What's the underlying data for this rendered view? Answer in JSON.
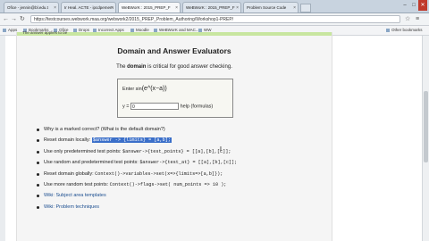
{
  "browser": {
    "tabs": [
      {
        "label": "Ofice - jennin@bl.edu.t"
      },
      {
        "label": "Ir Heal. ACTE - ipcdpemem"
      },
      {
        "label": "WeBWorK : 2015_PREP_F"
      },
      {
        "label": "WeBWorK : 2015_PREP_F"
      },
      {
        "label": "Problem Source Code"
      }
    ],
    "window_controls": {
      "min": "–",
      "max": "□",
      "close": "✕"
    },
    "url": "https://testcourses.webwork.maa.org/webwork2/2015_PREP_Problem_Authoring/Workshop1-PREP/",
    "bookmarks": [
      "Apps",
      "Bookmarks",
      "Ofice",
      "Drops",
      "Incorrect Apps",
      "Moodle",
      "WeBWorK and MAC...",
      "WW"
    ],
    "other_bookmarks": "Other bookmarks"
  },
  "page": {
    "header_partial": "The answer applies to be",
    "title": "Domain and Answer Evaluators",
    "intro_pre": "The ",
    "intro_bold": "domain",
    "intro_post": " is critical for good answer checking.",
    "demo": {
      "enter_label": "Enter sin",
      "enter_expr": "(e^(x−a))",
      "y_label": "y =",
      "y_value": "0",
      "help_text": "help (formulas)"
    },
    "items": [
      {
        "text": "Why is ",
        "code": "a",
        "after": " marked correct? (What is the default domain?)"
      },
      {
        "text": "Reset domain locally: ",
        "highlight": "$answer -> {limits} = [a,b];"
      },
      {
        "text": "Use only predetermined test points: ",
        "code": "$answer->{test_points} = [[a],[b],[c]];"
      },
      {
        "text": "Use random and predetermined test points: ",
        "code": "$answer->{test_at} = [[a],[b],[c]];"
      },
      {
        "text": "Reset domain globally: ",
        "code": "Context()->variables->set(x=>{limits=>[a,b]});"
      },
      {
        "text": "Use more random test points: ",
        "code": "Context()->flags->set( num_points => 10 );"
      },
      {
        "text": "",
        "link": "Wiki: Subject area templates"
      },
      {
        "text": "",
        "link": "Wiki: Problem techniques"
      }
    ]
  }
}
